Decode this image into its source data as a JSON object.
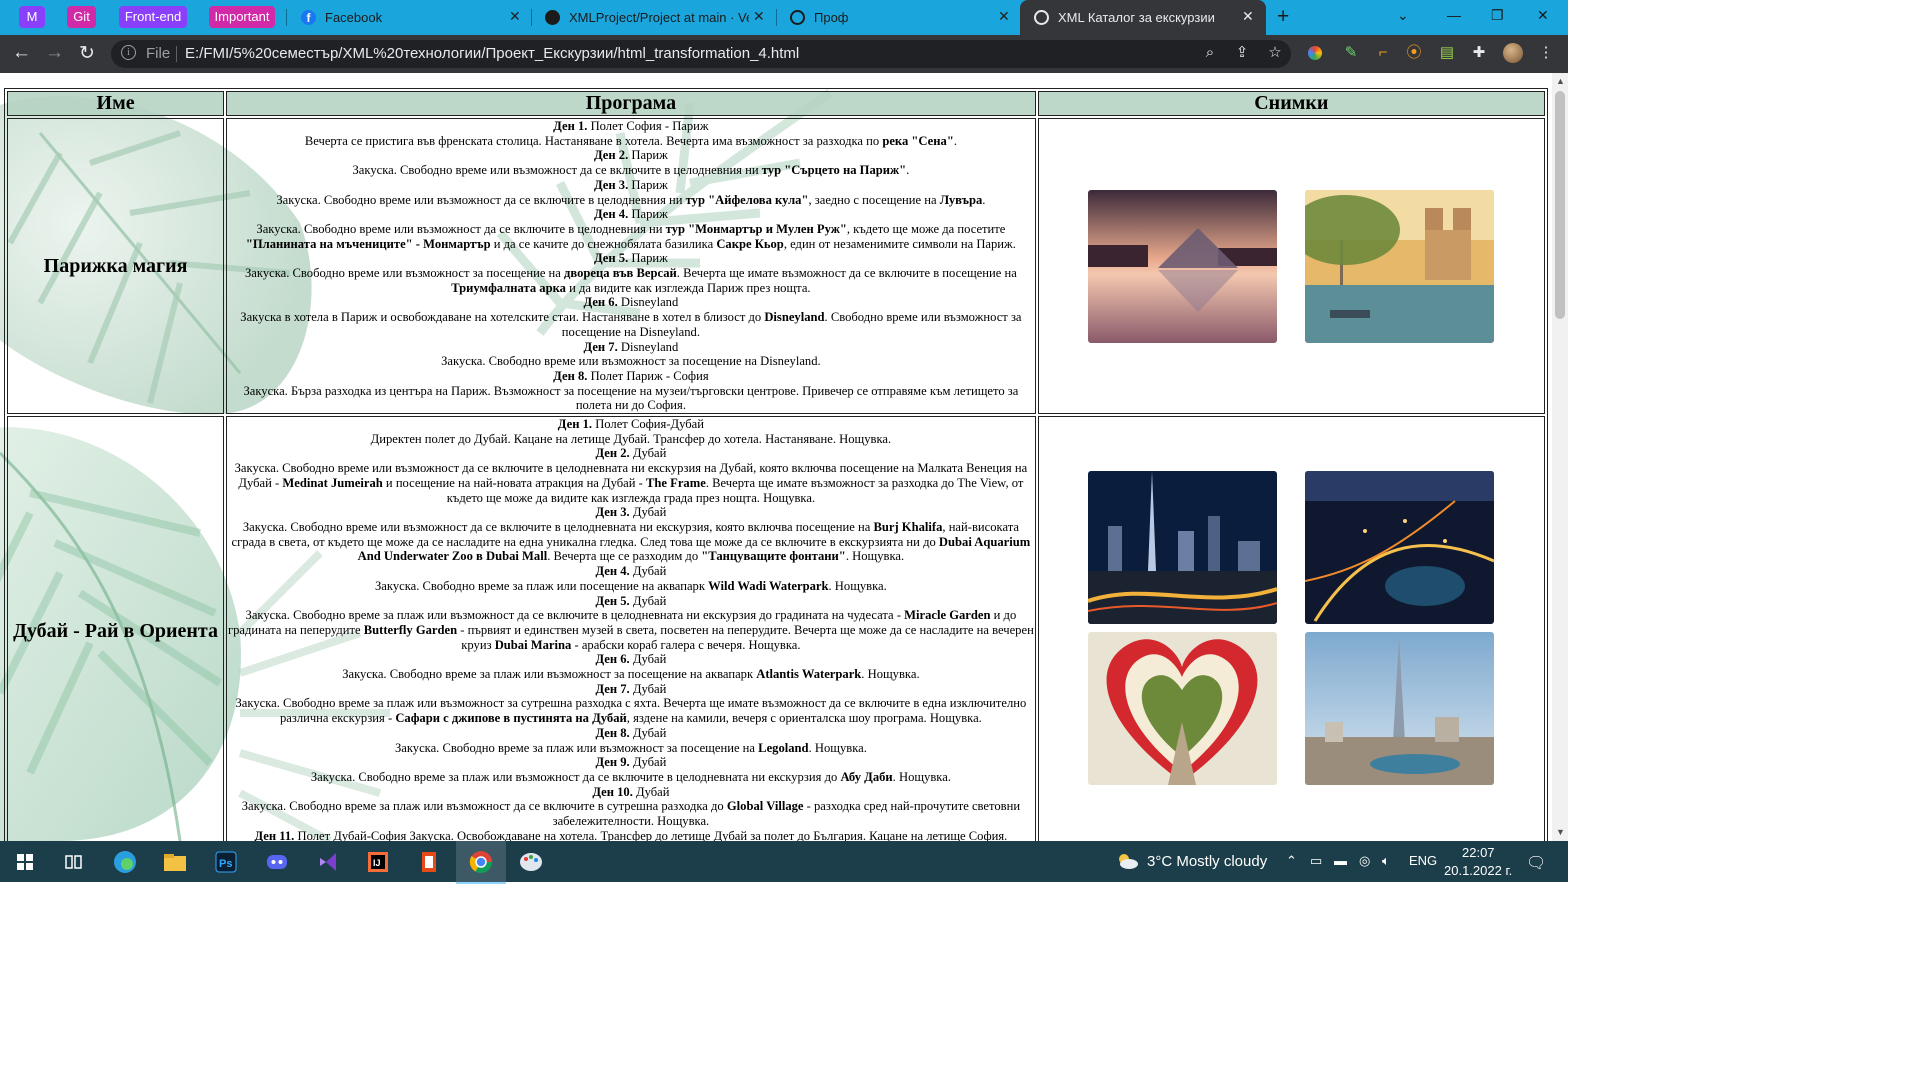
{
  "browser": {
    "bookmark_tabs": [
      {
        "label": "M",
        "color": "#8a3ffc"
      },
      {
        "label": "Git",
        "color": "#d12aa9"
      },
      {
        "label": "Front-end",
        "color": "#8a3ffc"
      },
      {
        "label": "Important",
        "color": "#d12aa9"
      }
    ],
    "tabs": [
      {
        "label": "Facebook",
        "icon": "facebook-icon"
      },
      {
        "label": "XMLProject/Project at main · Vesel",
        "icon": "github-icon"
      },
      {
        "label": "Проф",
        "icon": "globe-icon"
      },
      {
        "label": "XML Каталог за екскурзии",
        "icon": "globe-icon",
        "active": true
      }
    ],
    "omnibox": {
      "scheme_label": "File",
      "url": "E:/FMI/5%20семестър/XML%20технологии/Проект_Екскурзии/html_transformation_4.html"
    }
  },
  "table": {
    "headers": [
      "Име",
      "Програма",
      "Снимки"
    ],
    "rows": [
      {
        "name": "Парижка магия",
        "program": [
          {
            "day": "Ден 1.",
            "title": "Полет София - Париж",
            "html": "Вечерта се пристига във френската столица. Настаняване в хотела. Вечерта има възможност за разходка по <b>река \"Сена\"</b>."
          },
          {
            "day": "Ден 2.",
            "title": "Париж",
            "html": "Закуска. Свободно време или възможност да се включите в целодневния ни <b>тур \"Сърцето на Париж\"</b>."
          },
          {
            "day": "Ден 3.",
            "title": "Париж",
            "html": "Закуска. Свободно време или възможност да се включите в целодневния ни <b>тур \"Айфелова кула\"</b>, заедно с посещение на <b>Лувъра</b>."
          },
          {
            "day": "Ден 4.",
            "title": "Париж",
            "html": "Закуска. Свободно време или възможност да се включите в целодневния ни <b>тур \"Монмартър и Мулен Руж\"</b>, където ще може да посетите <b>\"Планината на мъчениците\" - Монмартър</b> и да се качите до снежнобялата базилика <b>Сакре Кьор</b>, един от незаменимите символи на Париж."
          },
          {
            "day": "Ден 5.",
            "title": "Париж",
            "html": "Закуска. Свободно време или възможност за посещение на <b>двореца във Версай</b>. Вечерта ще имате възможност да се включите в посещение на <b>Триумфалната арка</b> и да видите как изглежда Париж през нощта."
          },
          {
            "day": "Ден 6.",
            "title": "Disneyland",
            "html": "Закуска в хотела в Париж и освобождаване на хотелските стаи. Настаняване в хотел в близост до <b>Disneyland</b>. Свободно време или възможност за посещение на Disneyland."
          },
          {
            "day": "Ден 7.",
            "title": "Disneyland",
            "html": "Закуска. Свободно време или възможност за посещение на Disneyland."
          },
          {
            "day": "Ден 8.",
            "title": "Полет Париж - София",
            "html": "Закуска. Бърза разходка из центъра на Париж. Възможност за посещение на музеи/търговски центрове. Привечер се отправяме към летището за полета ни до София."
          }
        ],
        "photos": [
          "louvre-photo",
          "notre-dame-photo"
        ]
      },
      {
        "name": "Дубай - Рай в Ориента",
        "program": [
          {
            "day": "Ден 1.",
            "title": "Полет София-Дубай",
            "html": "Директен полет до Дубай. Кацане на летище Дубай. Трансфер до хотела. Настаняване. Нощувка."
          },
          {
            "day": "Ден 2.",
            "title": "Дубай",
            "html": "Закуска. Свободно време или възможност да се включите в целодневната ни екскурзия на Дубай, която включва посещение на Малката Венеция на Дубай - <b>Medinat Jumeirah</b> и посещение на най-новата атракция на Дубай - <b>The Frame</b>. Вечерта ще имате възможност за разходка до The View, от където ще може да видите как изглежда града през нощта. Нощувка."
          },
          {
            "day": "Ден 3.",
            "title": "Дубай",
            "html": "Закуска. Свободно време или възможност да се включите в целодневната ни екскурзия, която включва посещение на <b>Burj Khalifa</b>, най-високата сграда в света, от където ще може да се насладите на една уникална гледка. След това ще може да се включите в екскурзията ни до <b>Dubai Aquarium And Underwater Zoo в Dubai Mall</b>. Вечерта ще се разходим до <b>\"Танцуващите фонтани\"</b>. Нощувка."
          },
          {
            "day": "Ден 4.",
            "title": "Дубай",
            "html": "Закуска. Свободно време за плаж или посещение на аквапарк <b>Wild Wadi Waterpark</b>. Нощувка."
          },
          {
            "day": "Ден 5.",
            "title": "Дубай",
            "html": "Закуска. Свободно време за плаж или възможност да се включите в целодневната ни екскурзия до градината на чудесата - <b>Miracle Garden</b> и до градината на пеперудите <b>Butterfly Garden</b> - първият и единствен музей в света, посветен на пеперудите. Вечерта ще може да се насладите на вечерен круиз <b>Dubai Marina</b> - арабски кораб галера с вечеря. Нощувка."
          },
          {
            "day": "Ден 6.",
            "title": "Дубай",
            "html": "Закуска. Свободно време за плаж или възможност за посещение на аквапарк <b>Atlantis Waterpark</b>. Нощувка."
          },
          {
            "day": "Ден 7.",
            "title": "Дубай",
            "html": "Закуска. Свободно време за плаж или възможност за сутрешна разходка с яхта. Вечерта ще имате възможност да се включите в една изключително различна екскурзия - <b>Сафари с джипове в пустинята на Дубай</b>, яздене на камили, вечеря с ориенталска шоу програма. Нощувка."
          },
          {
            "day": "Ден 8.",
            "title": "Дубай",
            "html": "Закуска. Свободно време за плаж или възможност за посещение на <b>Legoland</b>. Нощувка."
          },
          {
            "day": "Ден 9.",
            "title": "Дубай",
            "html": "Закуска. Свободно време за плаж или възможност да се включите в целодневната ни екскурзия до <b>Абу Даби</b>. Нощувка."
          },
          {
            "day": "Ден 10.",
            "title": "Дубай",
            "html": "Закуска. Свободно време за плаж или възможност да се включите в сутрешна разходка до <b>Global Village</b> - разходка сред най-прочутите световни забележителности. Нощувка."
          },
          {
            "day": "Ден 11.",
            "title": "Полет Дубай-София",
            "inline": true,
            "html": "Закуска. Освобождаване на хотела. Трансфер до летище Дубай за полет до България. Кацане на летище София."
          }
        ],
        "photos": [
          "dubai-night-skyline-photo",
          "dubai-aerial-night-photo",
          "miracle-garden-heart-photo",
          "burj-khalifa-day-photo"
        ]
      }
    ]
  },
  "taskbar": {
    "weather": "3°C  Mostly cloudy",
    "language": "ENG",
    "time": "22:07",
    "date": "20.1.2022 г."
  }
}
